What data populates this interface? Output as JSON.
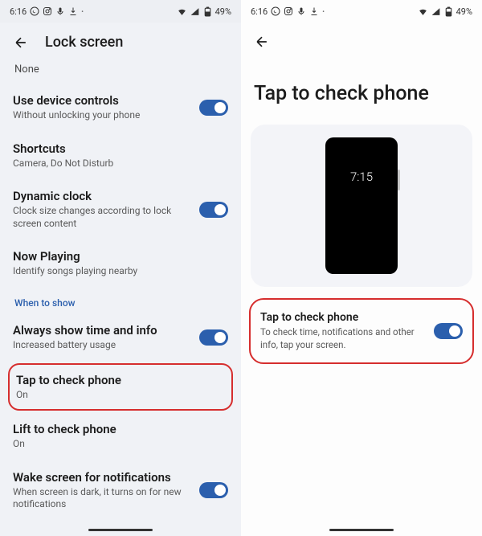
{
  "status": {
    "time": "6:16",
    "battery": "49%"
  },
  "left": {
    "appbar_title": "Lock screen",
    "none_label": "None",
    "items": {
      "device_controls": {
        "title": "Use device controls",
        "desc": "Without unlocking your phone"
      },
      "shortcuts": {
        "title": "Shortcuts",
        "desc": "Camera, Do Not Disturb"
      },
      "dynamic_clock": {
        "title": "Dynamic clock",
        "desc": "Clock size changes according to lock screen content"
      },
      "now_playing": {
        "title": "Now Playing",
        "desc": "Identify songs playing nearby"
      },
      "section_when": "When to show",
      "always_show": {
        "title": "Always show time and info",
        "desc": "Increased battery usage"
      },
      "tap_check": {
        "title": "Tap to check phone",
        "desc": "On"
      },
      "lift_check": {
        "title": "Lift to check phone",
        "desc": "On"
      },
      "wake_notif": {
        "title": "Wake screen for notifications",
        "desc": "When screen is dark, it turns on for new notifications"
      }
    }
  },
  "right": {
    "page_title": "Tap to check phone",
    "preview_time": "7:15",
    "detail": {
      "title": "Tap to check phone",
      "desc": "To check time, notifications and other info, tap your screen."
    }
  }
}
